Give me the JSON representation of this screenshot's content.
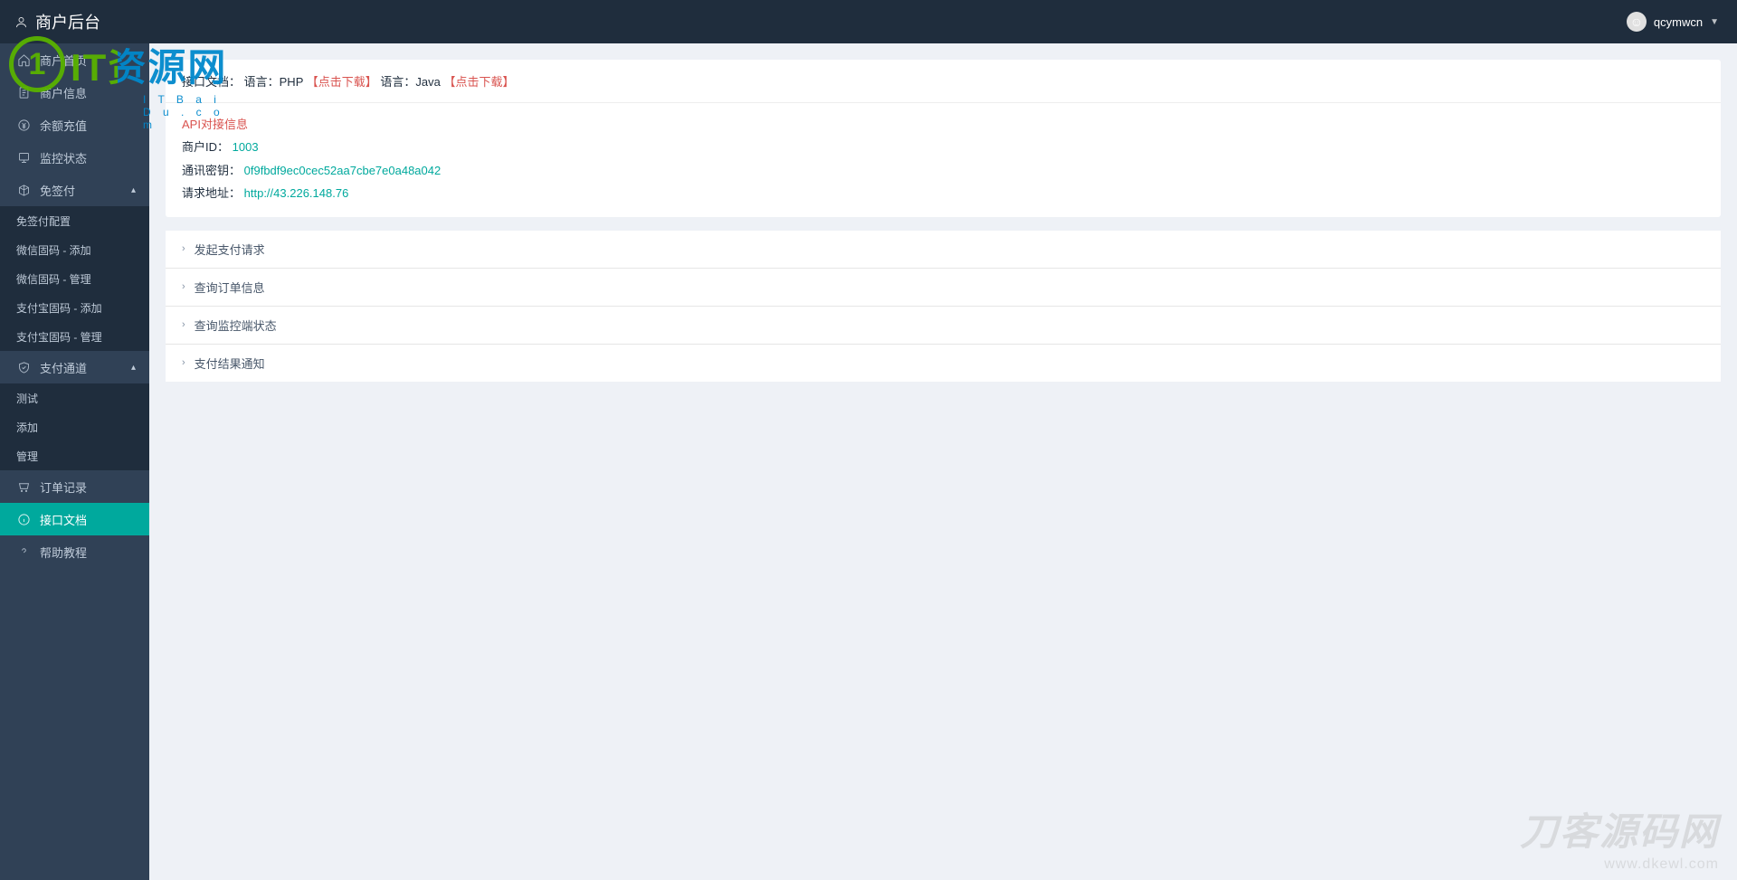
{
  "header": {
    "title": "商户后台",
    "username": "qcymwcn"
  },
  "sidebar": {
    "items": [
      {
        "label": "商户首页"
      },
      {
        "label": "商户信息"
      },
      {
        "label": "余额充值"
      },
      {
        "label": "监控状态"
      },
      {
        "label": "免签付",
        "expandable": true
      },
      {
        "label": "支付通道",
        "expandable": true
      },
      {
        "label": "订单记录"
      },
      {
        "label": "接口文档",
        "active": true
      },
      {
        "label": "帮助教程"
      }
    ],
    "sub_mianqian": [
      {
        "label": "免签付配置"
      },
      {
        "label": "微信固码 - 添加"
      },
      {
        "label": "微信固码 - 管理"
      },
      {
        "label": "支付宝固码 - 添加"
      },
      {
        "label": "支付宝固码 - 管理"
      }
    ],
    "sub_zhifu": [
      {
        "label": "测试"
      },
      {
        "label": "添加"
      },
      {
        "label": "管理"
      }
    ]
  },
  "panel": {
    "head_prefix": "接口文档：",
    "lang1_label": "语言：PHP",
    "download1": "【点击下载】",
    "lang2_label": " 语言：Java",
    "download2": "【点击下载】",
    "api_title": "API对接信息",
    "merchant_id_label": "商户ID：",
    "merchant_id_value": "1003",
    "secret_label": "通讯密钥：",
    "secret_value": "0f9fbdf9ec0cec52aa7cbe7e0a48a042",
    "url_label": "请求地址：",
    "url_value": "http://43.226.148.76"
  },
  "accordion": [
    {
      "label": "发起支付请求"
    },
    {
      "label": "查询订单信息"
    },
    {
      "label": "查询监控端状态"
    },
    {
      "label": "支付结果通知"
    }
  ],
  "watermark": {
    "logo_big": "IT资源网",
    "logo_sub": "I T B a i D u . c o m",
    "br_big": "刀客源码网",
    "br_url": "www.dkewl.com"
  }
}
